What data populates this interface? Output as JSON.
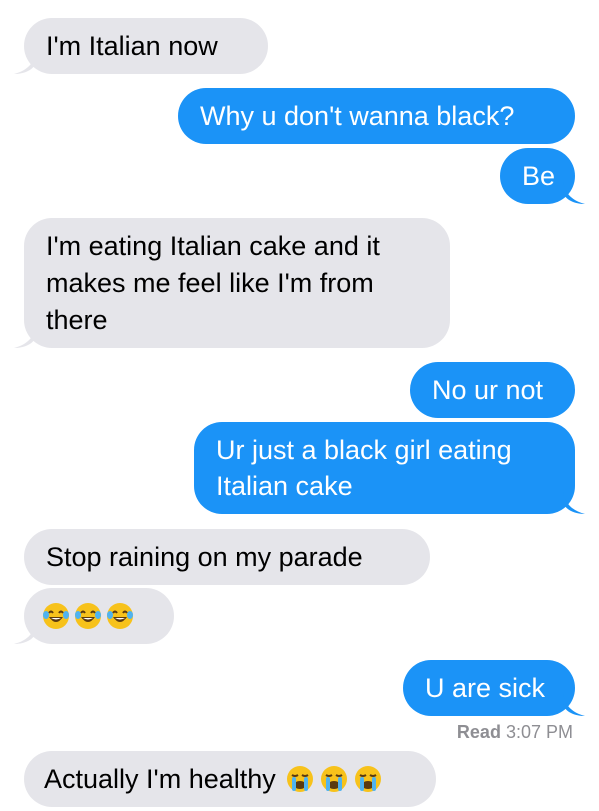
{
  "colors": {
    "received_bubble": "#e5e5ea",
    "sent_bubble": "#1b93f7",
    "received_text": "#000000",
    "sent_text": "#ffffff",
    "receipt_text": "#8e8e93"
  },
  "messages": [
    {
      "direction": "received",
      "text": "I'm Italian now"
    },
    {
      "direction": "sent",
      "text": "Why u don't wanna black?"
    },
    {
      "direction": "sent",
      "text": "Be"
    },
    {
      "direction": "received",
      "text": "I'm eating Italian cake and it makes me feel like I'm from there"
    },
    {
      "direction": "sent",
      "text": "No ur not"
    },
    {
      "direction": "sent",
      "text": "Ur just a black girl eating Italian cake"
    },
    {
      "direction": "received",
      "text": "Stop raining on my parade"
    },
    {
      "direction": "received",
      "emoji": [
        "laughing-tears-emoji",
        "laughing-tears-emoji",
        "laughing-tears-emoji"
      ]
    },
    {
      "direction": "sent",
      "text": "U are sick"
    },
    {
      "direction": "received",
      "text": "Actually I'm healthy",
      "emoji": [
        "crying-emoji",
        "crying-emoji",
        "crying-emoji"
      ]
    }
  ],
  "read_receipt": {
    "label": "Read",
    "time": "3:07 PM"
  }
}
